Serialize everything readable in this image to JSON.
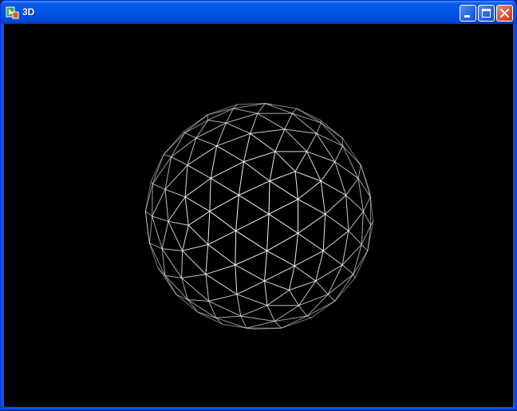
{
  "window": {
    "title": "3D",
    "icon": "app-icon",
    "buttons": [
      "minimize-icon",
      "maximize-icon",
      "close-icon"
    ]
  },
  "scene": {
    "object": "wireframe-sphere",
    "background": "#000000",
    "line_color": "#ffffff"
  }
}
